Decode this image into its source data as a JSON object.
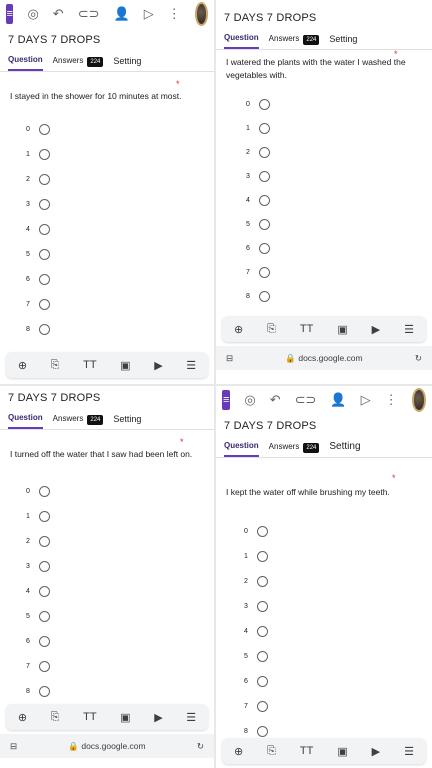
{
  "form_title": "7 DAYS 7 DROPS",
  "tabs": {
    "question": "Question",
    "answers": "Answers",
    "badge": "224",
    "setting": "Setting"
  },
  "required_mark": "*",
  "url": "docs.google.com",
  "toolbar_text_glyph": "TT",
  "scale_values": [
    "0",
    "1",
    "2",
    "3",
    "4",
    "5",
    "6",
    "7",
    "8"
  ],
  "panels": {
    "p1": {
      "question": "I stayed in the shower for 10 minutes at most."
    },
    "p2": {
      "question": "I watered the plants with the water I washed the vegetables with."
    },
    "p3": {
      "question": "I turned off the water that I saw had been left on."
    },
    "p4": {
      "question": "I kept the water off while brushing my teeth."
    }
  }
}
